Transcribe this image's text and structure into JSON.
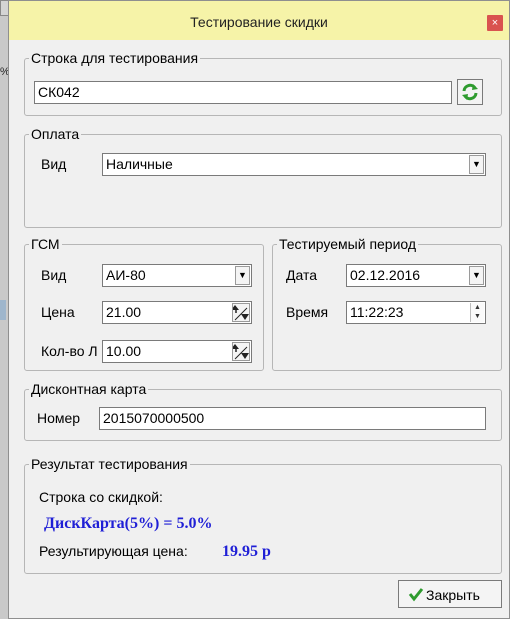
{
  "background": {
    "fragment": "%"
  },
  "window": {
    "title": "Тестирование скидки",
    "close_symbol": "×"
  },
  "test_string": {
    "legend": "Строка для тестирования",
    "value": "СК042"
  },
  "payment": {
    "legend": "Оплата",
    "type_label": "Вид",
    "type_value": "Наличные"
  },
  "fuel": {
    "legend": "ГСМ",
    "type_label": "Вид",
    "type_value": "АИ-80",
    "price_label": "Цена",
    "price_value": "21.00",
    "qty_label": "Кол-во Л",
    "qty_value": "10.00"
  },
  "period": {
    "legend": "Тестируемый период",
    "date_label": "Дата",
    "date_value": "02.12.2016",
    "time_label": "Время",
    "time_value": "11:22:23"
  },
  "card": {
    "legend": "Дисконтная карта",
    "number_label": "Номер",
    "number_value": "2015070000500"
  },
  "result": {
    "legend": "Результат тестирования",
    "discount_line_label": "Строка со скидкой:",
    "discount_line_value": "ДискКарта(5%) = 5.0%",
    "price_label": "Результирующая цена:",
    "price_value": "19.95 р"
  },
  "actions": {
    "close_label": "Закрыть"
  },
  "colors": {
    "title_bar": "#f6f3a8",
    "result_text": "#1f1fd6",
    "close_button": "#d9534f",
    "check_icon": "#2e9b2e"
  }
}
